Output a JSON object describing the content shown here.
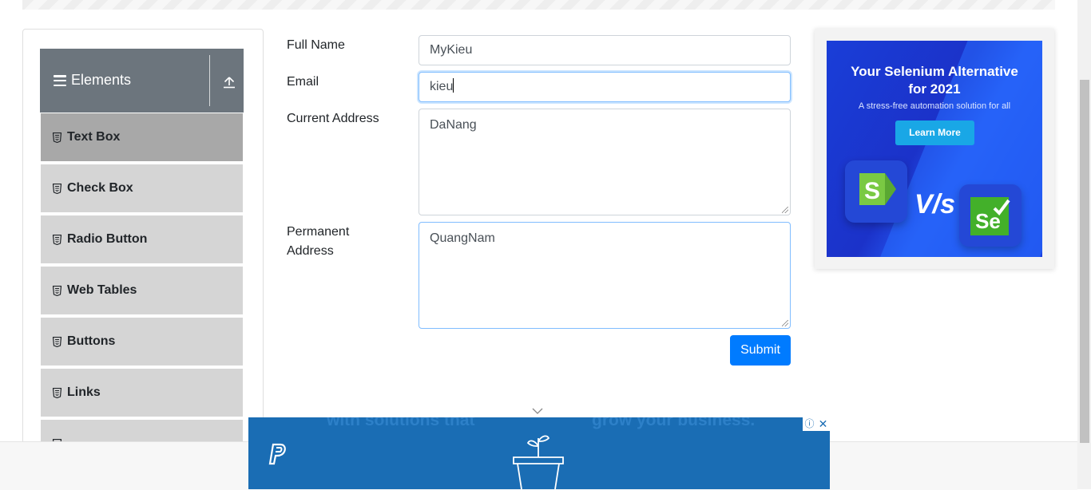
{
  "sidebar": {
    "group_title": "Elements",
    "items": [
      {
        "label": "Text Box",
        "active": true
      },
      {
        "label": "Check Box",
        "active": false
      },
      {
        "label": "Radio Button",
        "active": false
      },
      {
        "label": "Web Tables",
        "active": false
      },
      {
        "label": "Buttons",
        "active": false
      },
      {
        "label": "Links",
        "active": false
      }
    ]
  },
  "form": {
    "full_name_label": "Full Name",
    "full_name_value": "MyKieu",
    "email_label": "Email",
    "email_value": "kieu",
    "current_address_label": "Current Address",
    "current_address_value": "DaNang",
    "permanent_address_label_line1": "Permanent",
    "permanent_address_label_line2": "Address",
    "permanent_address_value": "QuangNam",
    "submit_label": "Submit"
  },
  "right_ad": {
    "title_line1": "Your Selenium Alternative",
    "title_line2": "for 2021",
    "subtitle": "A stress-free automation solution for all",
    "button_label": "Learn More",
    "vs_text": "V/s"
  },
  "bottom_ad": {
    "text_left": "with solutions that",
    "text_right": "grow your business.",
    "info_glyph": "ⓘ",
    "close_glyph": "✕"
  },
  "colors": {
    "primary": "#007bff",
    "sidebar_header": "#6c757d",
    "sidebar_item": "#d5d5d5",
    "sidebar_item_active": "#a8a8a8",
    "bottom_ad_bg": "#1a6db4"
  }
}
